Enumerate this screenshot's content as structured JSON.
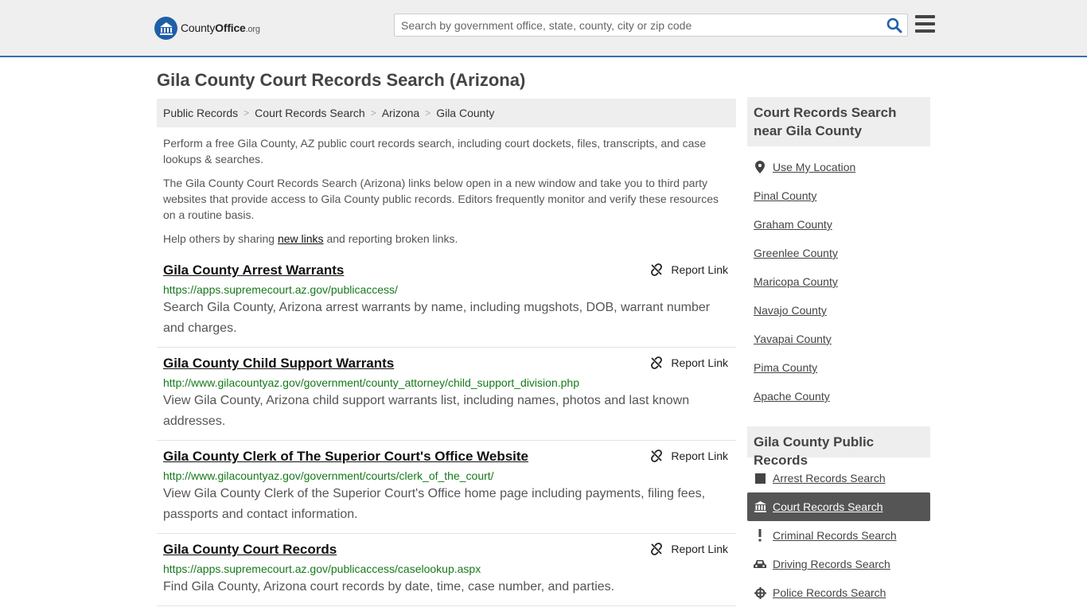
{
  "header": {
    "logo_main": "County",
    "logo_brand": "Office",
    "logo_tld": ".org",
    "search_placeholder": "Search by government office, state, county, city or zip code"
  },
  "page_title": "Gila County Court Records Search (Arizona)",
  "breadcrumb": [
    "Public Records",
    "Court Records Search",
    "Arizona",
    "Gila County"
  ],
  "intro": {
    "p1": "Perform a free Gila County, AZ public court records search, including court dockets, files, transcripts, and case lookups & searches.",
    "p2": "The Gila County Court Records Search (Arizona) links below open in a new window and take you to third party websites that provide access to Gila County public records. Editors frequently monitor and verify these resources on a routine basis.",
    "p3_before": "Help others by sharing ",
    "p3_link": "new links",
    "p3_after": " and reporting broken links."
  },
  "report_label": "Report Link",
  "records": [
    {
      "title": "Gila County Arrest Warrants",
      "url": "https://apps.supremecourt.az.gov/publicaccess/",
      "desc": "Search Gila County, Arizona arrest warrants by name, including mugshots, DOB, warrant number and charges."
    },
    {
      "title": "Gila County Child Support Warrants",
      "url": "http://www.gilacountyaz.gov/government/county_attorney/child_support_division.php",
      "desc": "View Gila County, Arizona child support warrants list, including names, photos and last known addresses."
    },
    {
      "title": "Gila County Clerk of The Superior Court's Office Website",
      "url": "http://www.gilacountyaz.gov/government/courts/clerk_of_the_court/",
      "desc": "View Gila County Clerk of the Superior Court's Office home page including payments, filing fees, passports and contact information."
    },
    {
      "title": "Gila County Court Records",
      "url": "https://apps.supremecourt.az.gov/publicaccess/caselookup.aspx",
      "desc": "Find Gila County, Arizona court records by date, time, case number, and parties."
    }
  ],
  "sidebar": {
    "near_title": "Court Records Search near Gila County",
    "use_location": "Use My Location",
    "nearby": [
      "Pinal County",
      "Graham County",
      "Greenlee County",
      "Maricopa County",
      "Navajo County",
      "Yavapai County",
      "Pima County",
      "Apache County"
    ],
    "public_title": "Gila County Public Records",
    "public_records": [
      {
        "label": "Arrest Records Search",
        "icon": "square-icon",
        "active": false
      },
      {
        "label": "Court Records Search",
        "icon": "courthouse-icon",
        "active": true
      },
      {
        "label": "Criminal Records Search",
        "icon": "exclamation-icon",
        "active": false
      },
      {
        "label": "Driving Records Search",
        "icon": "car-icon",
        "active": false
      },
      {
        "label": "Police Records Search",
        "icon": "crosshair-icon",
        "active": false
      }
    ]
  },
  "colors": {
    "accent": "#3b6ea6",
    "url_green": "#16791b",
    "active_bg": "#555555"
  }
}
